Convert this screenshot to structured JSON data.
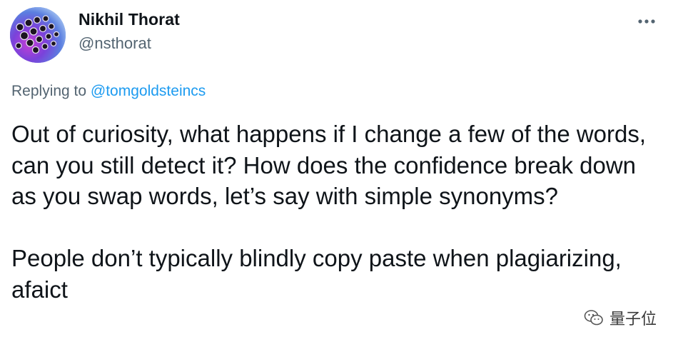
{
  "author": {
    "display_name": "Nikhil Thorat",
    "handle": "@nsthorat"
  },
  "reply": {
    "prefix": "Replying to ",
    "mention": "@tomgoldsteincs"
  },
  "tweet": {
    "paragraph_1": "Out of curiosity, what happens if I change a few of the words, can you still detect it? How does the confidence break down as you swap words, let’s say with simple synonyms?",
    "paragraph_2": "People don’t typically blindly copy paste when plagiarizing, afaict"
  },
  "watermark": {
    "text": "量子位"
  },
  "icons": {
    "more": "more-horizontal-icon",
    "watermark_logo": "wechat-logo-icon"
  },
  "colors": {
    "text_primary": "#0f1419",
    "text_secondary": "#536471",
    "link": "#1d9bf0"
  }
}
